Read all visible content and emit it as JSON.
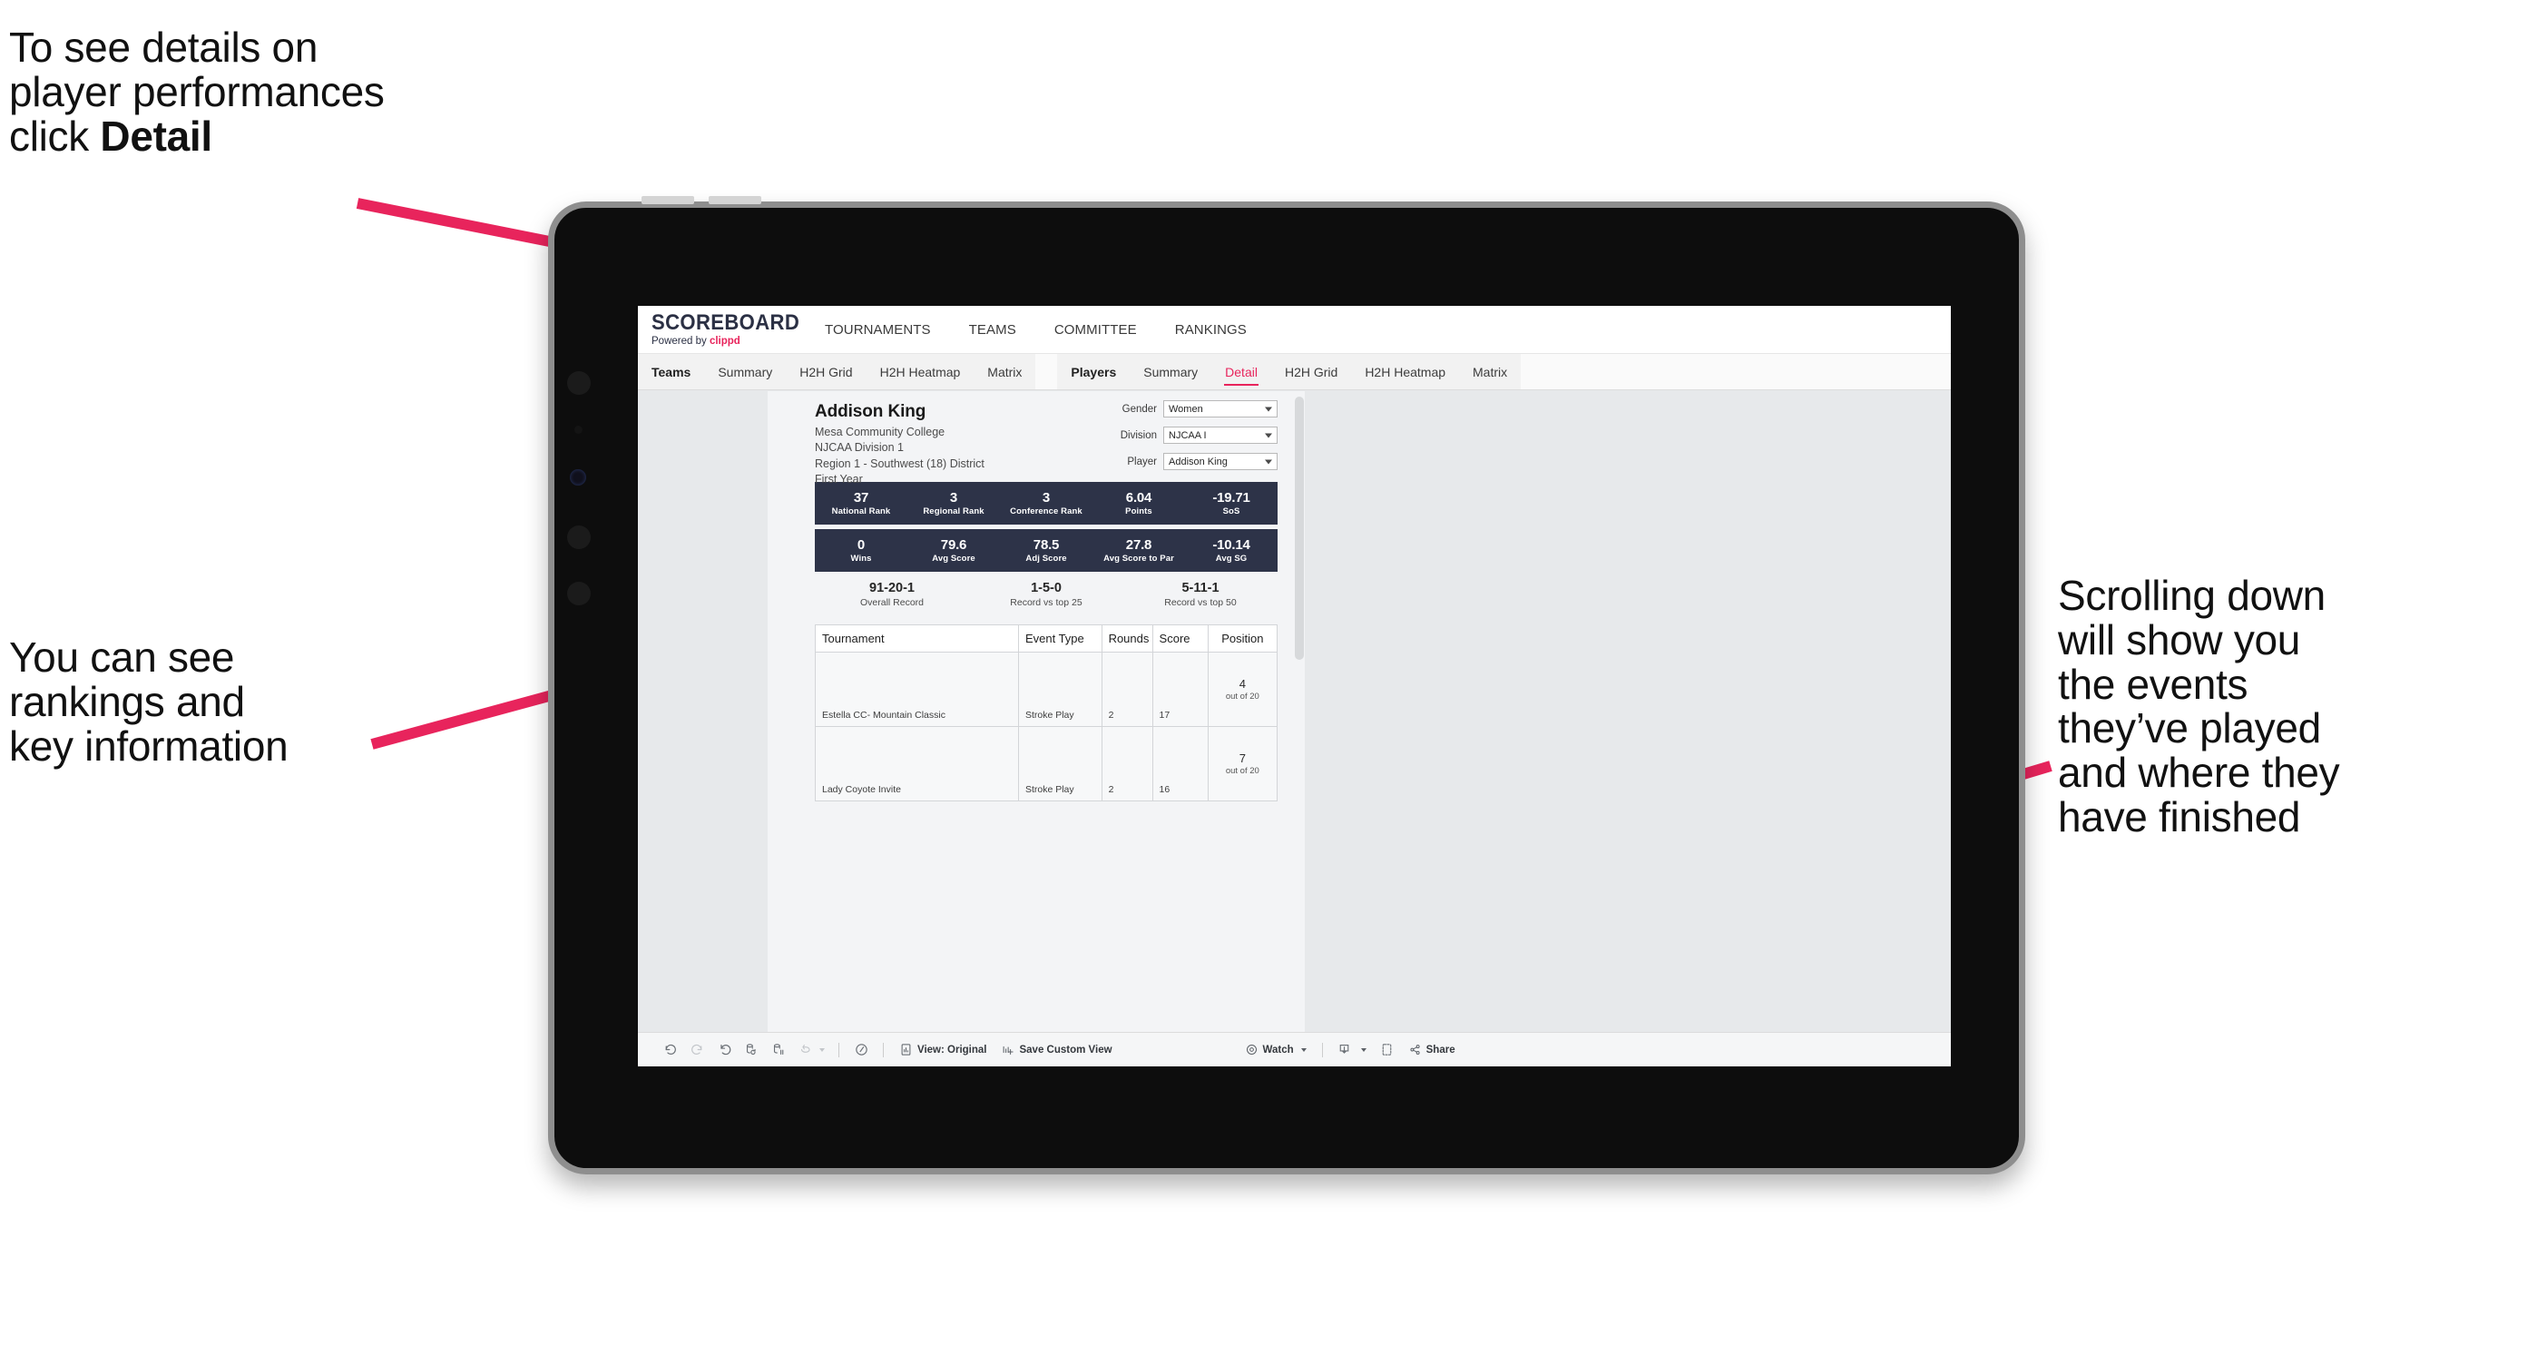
{
  "annotations": {
    "top_left": "To see details on\nplayer performances\nclick ",
    "top_left_bold": "Detail",
    "mid_left": "You can see\nrankings and\nkey information",
    "right": "Scrolling down\nwill show you\nthe events\nthey’ve played\nand where they\nhave finished"
  },
  "colors": {
    "accent_pink": "#e8245c",
    "stat_navy": "#2d3348",
    "page_bg": "#e7e9eb"
  },
  "app": {
    "brand": {
      "title": "SCOREBOARD",
      "powered_prefix": "Powered by ",
      "powered_name": "clippd"
    },
    "topnav": [
      "TOURNAMENTS",
      "TEAMS",
      "COMMITTEE",
      "RANKINGS"
    ],
    "tabs_group1": [
      "Teams",
      "Summary",
      "H2H Grid",
      "H2H Heatmap",
      "Matrix"
    ],
    "tabs_group2": [
      "Players",
      "Summary",
      "Detail",
      "H2H Grid",
      "H2H Heatmap",
      "Matrix"
    ],
    "active_tab": "Detail"
  },
  "player": {
    "name": "Addison King",
    "school": "Mesa Community College",
    "division": "NJCAA Division 1",
    "region": "Region 1 - Southwest (18) District",
    "year": "First Year"
  },
  "filters": [
    {
      "label": "Gender",
      "value": "Women"
    },
    {
      "label": "Division",
      "value": "NJCAA I"
    },
    {
      "label": "Player",
      "value": "Addison King"
    }
  ],
  "stats_row1": [
    {
      "value": "37",
      "label": "National Rank"
    },
    {
      "value": "3",
      "label": "Regional Rank"
    },
    {
      "value": "3",
      "label": "Conference Rank"
    },
    {
      "value": "6.04",
      "label": "Points"
    },
    {
      "value": "-19.71",
      "label": "SoS"
    }
  ],
  "stats_row2": [
    {
      "value": "0",
      "label": "Wins"
    },
    {
      "value": "79.6",
      "label": "Avg Score"
    },
    {
      "value": "78.5",
      "label": "Adj Score"
    },
    {
      "value": "27.8",
      "label": "Avg Score to Par"
    },
    {
      "value": "-10.14",
      "label": "Avg SG"
    }
  ],
  "records": [
    {
      "value": "91-20-1",
      "label": "Overall Record"
    },
    {
      "value": "1-5-0",
      "label": "Record vs top 25"
    },
    {
      "value": "5-11-1",
      "label": "Record vs top 50"
    }
  ],
  "tournament_table": {
    "headers": [
      "Tournament",
      "Event Type",
      "Rounds",
      "Score",
      "Position"
    ],
    "rows": [
      {
        "tournament": "Estella CC- Mountain Classic",
        "event_type": "Stroke Play",
        "rounds": "2",
        "score": "17",
        "position": "4",
        "position_out_of": "out of 20"
      },
      {
        "tournament": "Lady Coyote Invite",
        "event_type": "Stroke Play",
        "rounds": "2",
        "score": "16",
        "position": "7",
        "position_out_of": "out of 20"
      }
    ]
  },
  "toolbar": {
    "view_original": "View: Original",
    "save_custom_view": "Save Custom View",
    "watch": "Watch",
    "share": "Share"
  }
}
